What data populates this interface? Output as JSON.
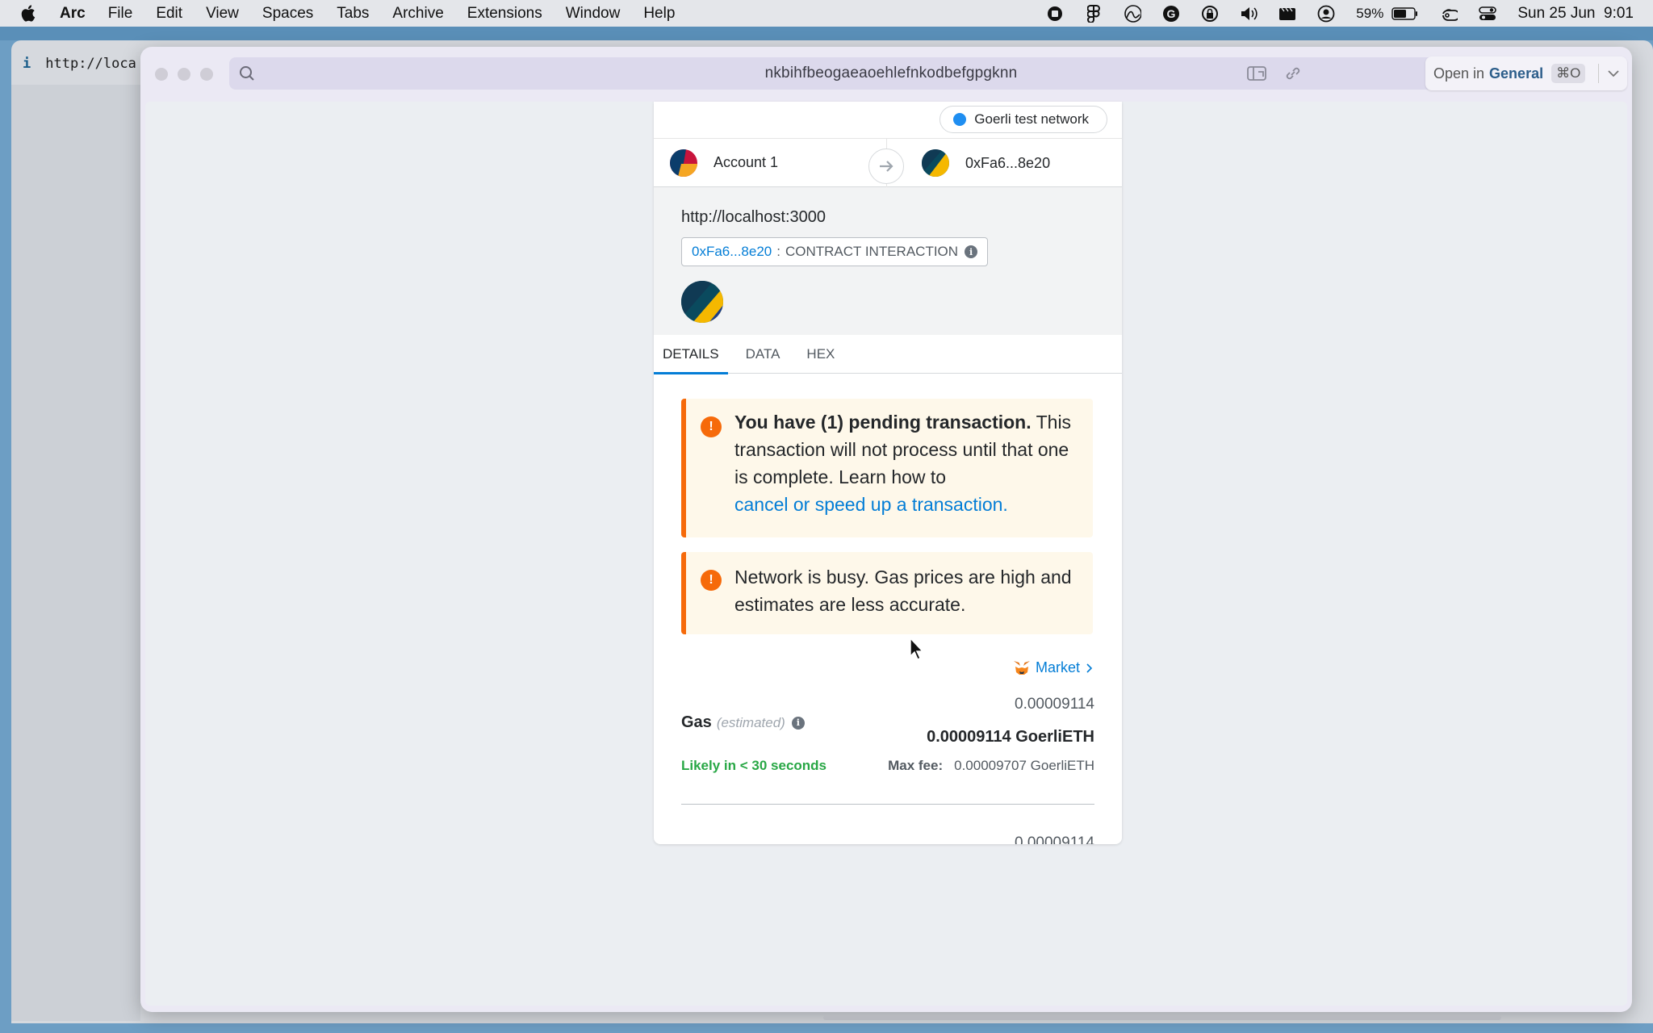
{
  "menubar": {
    "app_name": "Arc",
    "items": [
      "File",
      "Edit",
      "View",
      "Spaces",
      "Tabs",
      "Archive",
      "Extensions",
      "Window",
      "Help"
    ],
    "battery": "59%",
    "datetime": "Sun 25 Jun  9:01"
  },
  "background_tab": {
    "info_icon": "i",
    "url": "http://loca"
  },
  "popup": {
    "url": "nkbihfbeogaeaoehlefnkodbefgpgknn",
    "open_in_prefix": "Open in",
    "open_in_space": "General",
    "open_in_shortcut": "⌘O"
  },
  "metamask": {
    "network": "Goerli test network",
    "network_color": "#1f8ef1",
    "from_account": "Account 1",
    "to_account": "0xFa6...8e20",
    "origin": "http://localhost:3000",
    "method_address": "0xFa6...8e20",
    "method_separator": ":",
    "method_label": "CONTRACT INTERACTION",
    "tabs": [
      "DETAILS",
      "DATA",
      "HEX"
    ],
    "active_tab": "DETAILS",
    "alert1": {
      "bold": "You have (1) pending transaction.",
      "text": " This transaction will not process until that one is complete. Learn how to",
      "link": "cancel or speed up a transaction."
    },
    "alert2": {
      "text": "Network is busy. Gas prices are high and estimates are less accurate."
    },
    "market_label": "Market",
    "gas": {
      "label": "Gas",
      "estimated": "(estimated)",
      "top_value": "0.00009114",
      "main_value": "0.00009114 GoerliETH",
      "likely": "Likely in < 30 seconds",
      "max_fee_label": "Max fee:",
      "max_fee_value": "0.00009707 GoerliETH",
      "bottom_value": "0.00009114"
    }
  },
  "colors": {
    "accent": "#037dd6",
    "warning": "#f66a0a",
    "success": "#28a745"
  }
}
